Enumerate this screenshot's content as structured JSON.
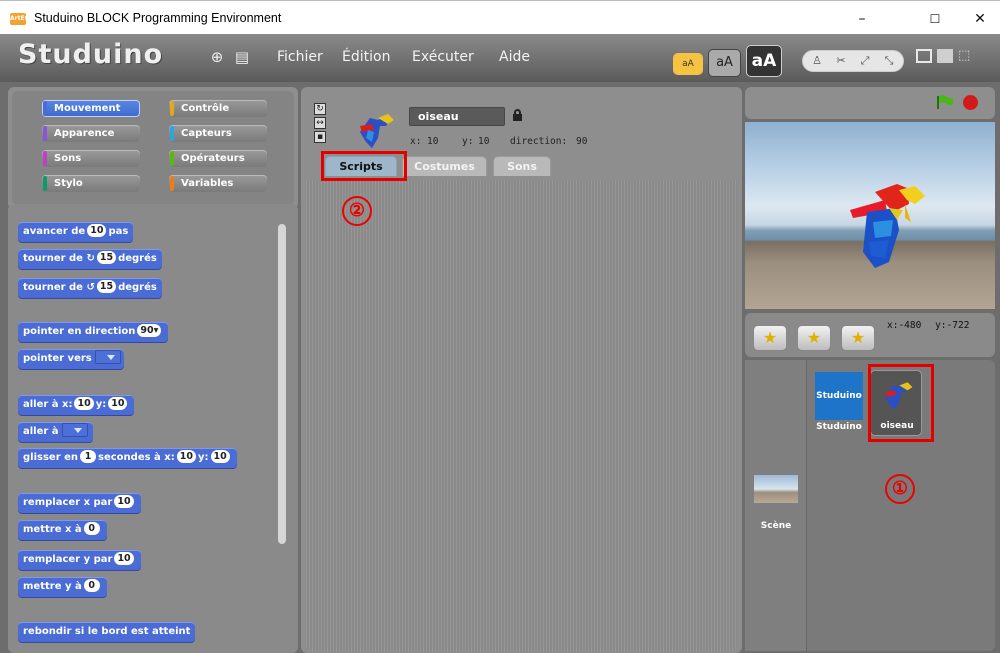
{
  "window": {
    "title": "Studuino BLOCK Programming Environment",
    "icon_text": "ArtEC",
    "minimize": "–",
    "maximize": "☐",
    "close": "✕"
  },
  "menubar": {
    "logo": "Studuino",
    "items": [
      "Fichier",
      "Édition",
      "Exécuter",
      "Aide"
    ],
    "font_small": "aA",
    "font_medium": "aA",
    "font_large": "aA"
  },
  "categories": [
    {
      "label": "Mouvement",
      "color": "#4a6cd4",
      "active": true
    },
    {
      "label": "Contrôle",
      "color": "#e1a91a"
    },
    {
      "label": "Apparence",
      "color": "#8a55d7"
    },
    {
      "label": "Capteurs",
      "color": "#2ca5e2"
    },
    {
      "label": "Sons",
      "color": "#bb42c3"
    },
    {
      "label": "Opérateurs",
      "color": "#5cb712"
    },
    {
      "label": "Stylo",
      "color": "#0e9a6c"
    },
    {
      "label": "Variables",
      "color": "#ee7d16"
    }
  ],
  "blocks": {
    "move_a": "avancer de",
    "move_n": "10",
    "move_b": "pas",
    "turn_a": "tourner de",
    "turn_n": "15",
    "turn_b": "degrés",
    "turn2_a": "tourner de",
    "turn2_n": "15",
    "turn2_b": "degrés",
    "point_dir": "pointer en direction",
    "point_dir_n": "90▾",
    "point_to": "pointer vers",
    "goto_xy_a": "aller à x:",
    "goto_xy_x": "10",
    "goto_xy_b": "y:",
    "goto_xy_y": "10",
    "goto": "aller à",
    "glide_a": "glisser en",
    "glide_n": "1",
    "glide_b": "secondes à x:",
    "glide_x": "10",
    "glide_c": "y:",
    "glide_y": "10",
    "change_x": "remplacer x par",
    "change_x_n": "10",
    "set_x": "mettre x à",
    "set_x_n": "0",
    "change_y": "remplacer y par",
    "change_y_n": "10",
    "set_y": "mettre y à",
    "set_y_n": "0",
    "bounce": "rebondir si le bord est atteint"
  },
  "sprite": {
    "name": "oiseau",
    "x_label": "x:",
    "x": "10",
    "y_label": "y:",
    "y": "10",
    "dir_label": "direction:",
    "dir": "90"
  },
  "tabs": [
    "Scripts",
    "Costumes",
    "Sons"
  ],
  "stage": {
    "mouse_x_label": "x:",
    "mouse_x": "-480",
    "mouse_y_label": "y:",
    "mouse_y": "-722"
  },
  "sprites_list": [
    {
      "label": "Studuino",
      "thumb_text": "Studuino"
    },
    {
      "label": "oiseau"
    }
  ],
  "scene_label": "Scène",
  "annotations": {
    "one": "①",
    "two": "②"
  },
  "colors": {
    "accent_red": "#e50000",
    "motion_blue": "#4a6cd4"
  }
}
